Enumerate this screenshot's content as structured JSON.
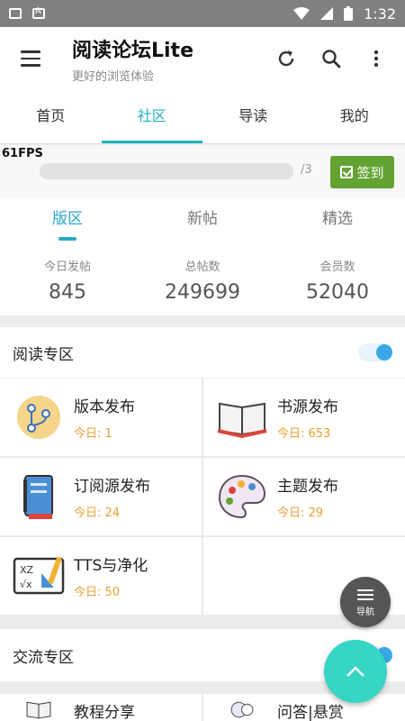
{
  "status": {
    "time": "1:32"
  },
  "app_bar": {
    "title": "阅读论坛Lite",
    "subtitle": "更好的浏览体验"
  },
  "tabs": [
    "首页",
    "社区",
    "导读",
    "我的"
  ],
  "checkin": {
    "fps": "61FPS",
    "progress_text": "/3",
    "button_label": "签到",
    "progress": 0
  },
  "subtabs": [
    "版区",
    "新帖",
    "精选"
  ],
  "stats": [
    {
      "label": "今日发帖",
      "value": "845"
    },
    {
      "label": "总帖数",
      "value": "249699"
    },
    {
      "label": "会员数",
      "value": "52040"
    }
  ],
  "sections": [
    {
      "title": "阅读专区",
      "boards": [
        {
          "name": "版本发布",
          "today": "今日: 1",
          "icon": "branch-icon"
        },
        {
          "name": "书源发布",
          "today": "今日: 653",
          "icon": "book-icon"
        },
        {
          "name": "订阅源发布",
          "today": "今日: 24",
          "icon": "notebook-icon"
        },
        {
          "name": "主题发布",
          "today": "今日: 29",
          "icon": "palette-icon"
        },
        {
          "name": "TTS与净化",
          "today": "今日: 50",
          "icon": "math-tools-icon"
        }
      ]
    },
    {
      "title": "交流专区",
      "boards": [
        {
          "name": "教程分享",
          "icon": "book-icon"
        },
        {
          "name": "问答|悬赏",
          "icon": "qa-icon"
        }
      ]
    }
  ],
  "fab": {
    "nav_label": "导航"
  },
  "colors": {
    "accent": "#20b3c0",
    "checkin": "#62a332",
    "today": "#e8a033",
    "fab": "#36d5c5"
  }
}
